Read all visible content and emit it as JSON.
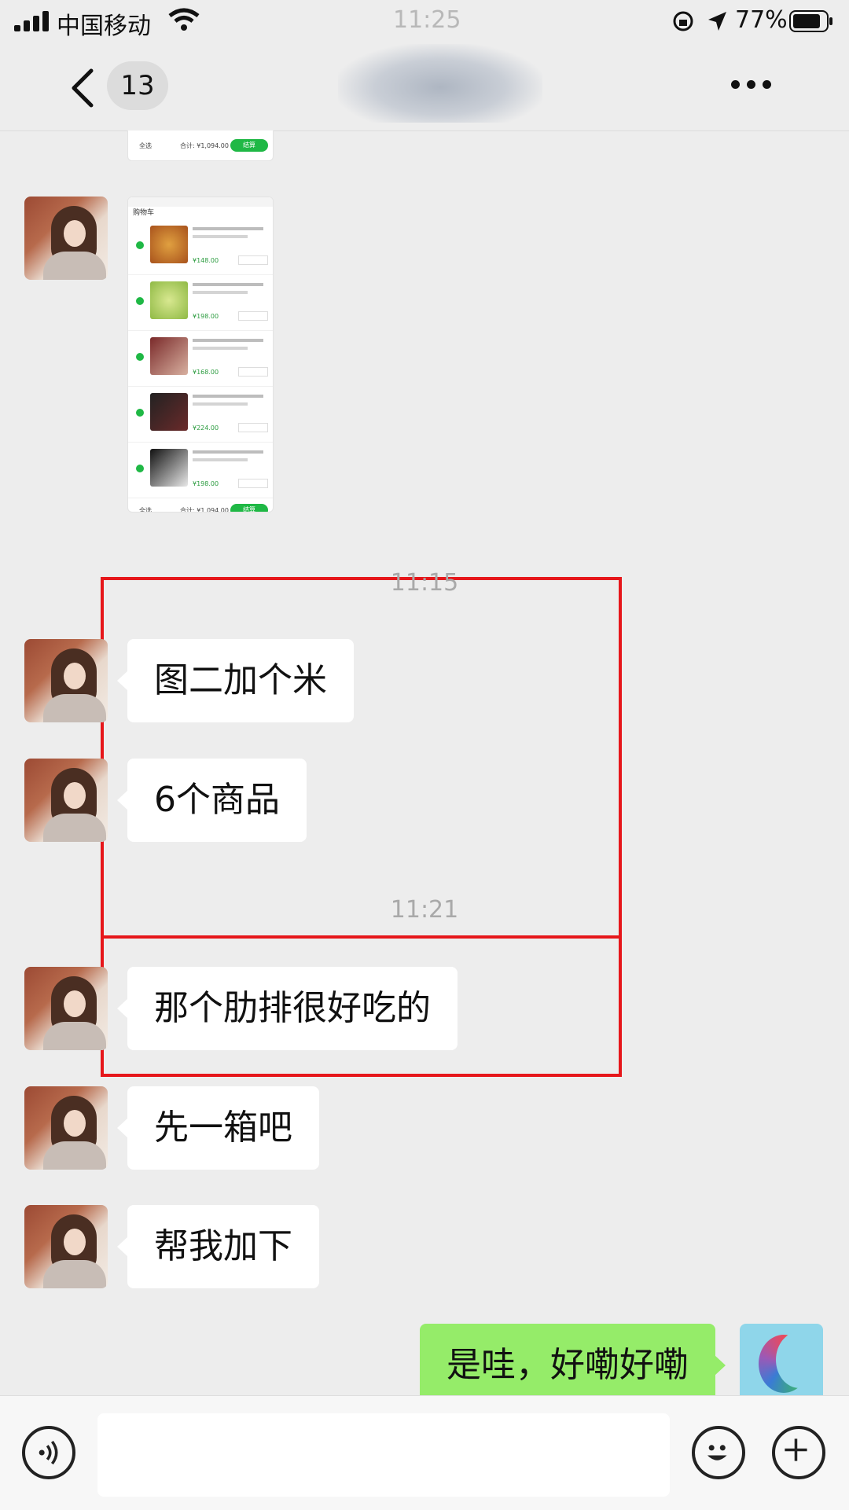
{
  "status_bar": {
    "carrier": "中国移动",
    "time": "11:25",
    "battery": "77%"
  },
  "nav": {
    "unread_count": "13"
  },
  "top_screenshot": {
    "footer_select_all": "全选",
    "footer_total": "合计: ¥1,094.00",
    "footer_checkout": "结算"
  },
  "cart_screenshot": {
    "header": "购物车",
    "items": [
      {
        "price": "¥148.00"
      },
      {
        "price": "¥198.00"
      },
      {
        "price": "¥168.00"
      },
      {
        "price": "¥224.00"
      },
      {
        "price": "¥198.00"
      }
    ],
    "footer_select_all": "全选",
    "footer_total": "合计: ¥1,094.00",
    "footer_checkout": "结算"
  },
  "messages": {
    "ts1": "11:15",
    "m1": "图二加个米",
    "m2": "6个商品",
    "ts2": "11:21",
    "m3": "那个肋排很好吃的",
    "m4": "先一箱吧",
    "m5": "帮我加下",
    "m6": "是哇，好嘞好嘞"
  },
  "colors": {
    "my_bubble": "#95ec69",
    "highlight_box": "#e6171b",
    "chat_background": "#ededed"
  }
}
